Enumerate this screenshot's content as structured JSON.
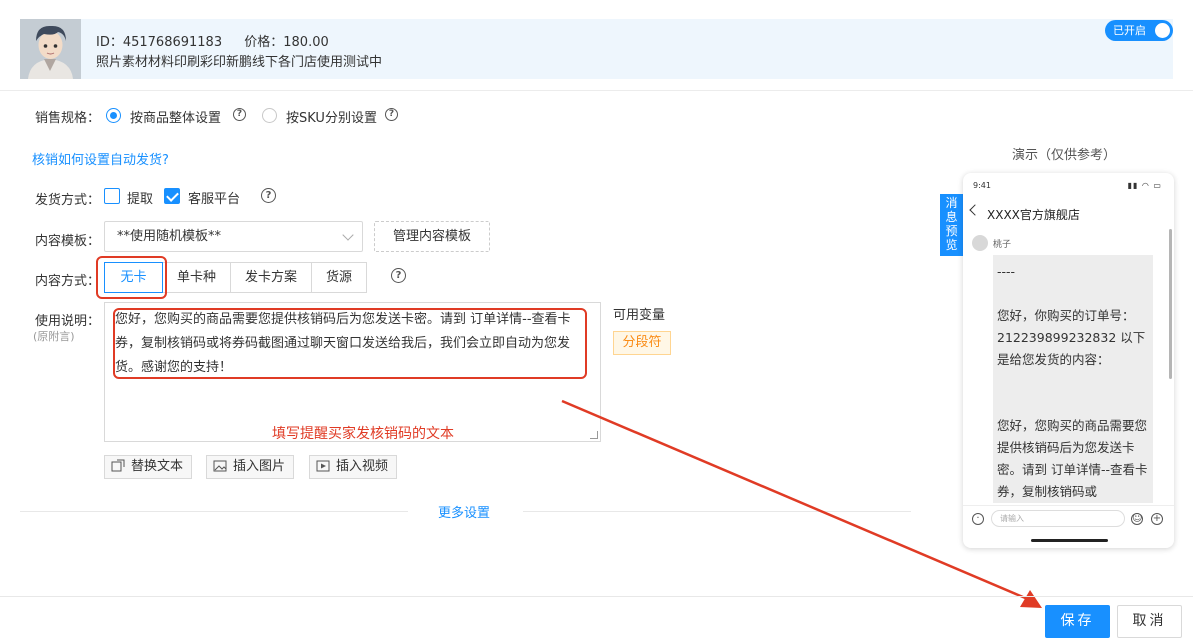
{
  "product": {
    "id_text": "ID：451768691183",
    "price_text": "价格：180.00",
    "name": "照片素材材料印刷彩印新鹏线下各门店使用测试中",
    "toggle_label": "已开启"
  },
  "sales_spec": {
    "label": "销售规格：",
    "option_whole": "按商品整体设置",
    "option_sku": "按SKU分别设置",
    "selected": "按商品整体设置"
  },
  "help_link": "核销如何设置自动发货?",
  "delivery": {
    "label": "发货方式：",
    "option_pickup": "提取",
    "option_platform": "客服平台",
    "pickup_checked": false,
    "platform_checked": true
  },
  "template": {
    "label": "内容模板：",
    "selected": "**使用随机模板**",
    "manage_button": "管理内容模板"
  },
  "content_mode": {
    "label": "内容方式：",
    "tabs": [
      "无卡",
      "单卡种",
      "发卡方案",
      "货源"
    ],
    "active": "无卡"
  },
  "usage": {
    "label": "使用说明：",
    "sublabel": "(原附言)",
    "text": "您好，您购买的商品需要您提供核销码后为您发送卡密。请到 订单详情--查看卡券，复制核销码或将券码截图通过聊天窗口发送给我后，我们会立即自动为您发货。感谢您的支持！",
    "annotation": "填写提醒买家发核销码的文本",
    "vars_label": "可用变量",
    "var_tag": "分段符"
  },
  "toolbar": {
    "replace_text": "替换文本",
    "insert_image": "插入图片",
    "insert_video": "插入视频"
  },
  "more_settings": "更多设置",
  "preview": {
    "title": "演示（仅供参考）",
    "side_tab": "消息预览",
    "time": "9:41",
    "shop_name": "XXXX官方旗舰店",
    "user_name": "桃子",
    "bubble_lines": [
      "----",
      "",
      "您好，你购买的订单号：212239899232832 以下是给您发货的内容：",
      "",
      "",
      "您好，您购买的商品需要您提供核销码后为您发送卡密。请到 订单详情--查看卡券，复制核销码或"
    ],
    "input_placeholder": "请输入"
  },
  "footer": {
    "save": "保存",
    "cancel": "取消"
  },
  "colors": {
    "accent": "#1890ff",
    "annotation_red": "#e03b25",
    "tag_orange": "#fa8c16"
  }
}
